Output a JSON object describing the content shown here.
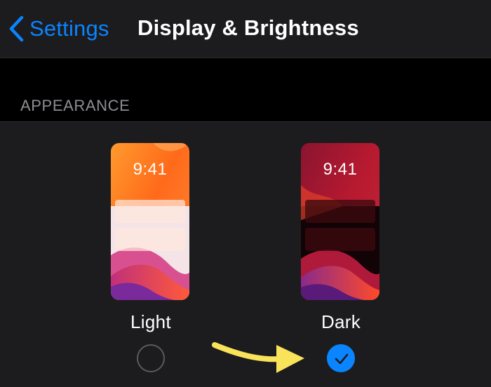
{
  "navbar": {
    "back_label": "Settings",
    "title": "Display & Brightness"
  },
  "section": {
    "title": "APPEARANCE"
  },
  "appearance_options": [
    {
      "label": "Light",
      "time": "9:41",
      "selected": false
    },
    {
      "label": "Dark",
      "time": "9:41",
      "selected": true
    }
  ],
  "colors": {
    "background": "#000000",
    "panel": "#1c1c1e",
    "accent_blue": "#0a84ff",
    "section_text": "#8e8e93",
    "annotation_arrow": "#f9e35a"
  },
  "icons": {
    "back": "chevron-left-icon",
    "selected": "checkmark-icon",
    "annotation": "arrow-right-icon"
  }
}
